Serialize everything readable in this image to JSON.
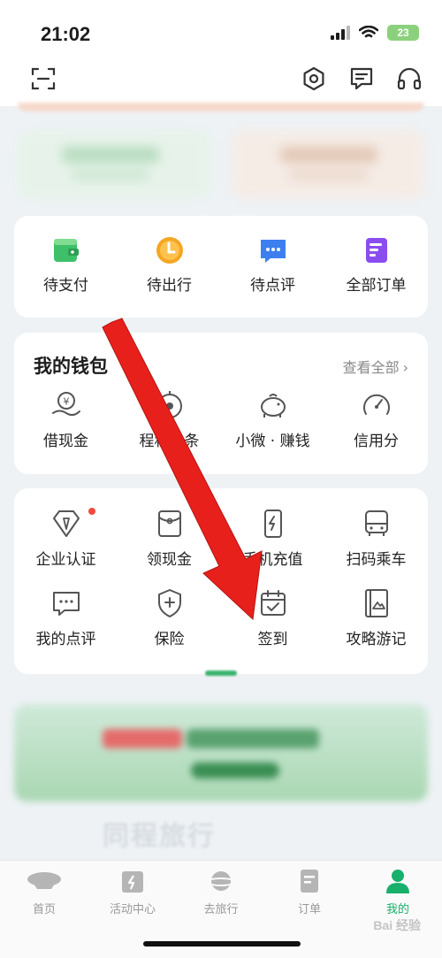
{
  "status_bar": {
    "time": "21:02",
    "battery": "23"
  },
  "orders": {
    "items": [
      {
        "label": "待支付",
        "icon": "wallet-icon"
      },
      {
        "label": "待出行",
        "icon": "clock-icon"
      },
      {
        "label": "待点评",
        "icon": "comment-icon"
      },
      {
        "label": "全部订单",
        "icon": "order-list-icon"
      }
    ]
  },
  "wallet": {
    "title": "我的钱包",
    "more": "查看全部",
    "items": [
      {
        "label": "借现金",
        "icon": "cash-hand-icon"
      },
      {
        "label": "程程白条",
        "icon": "credit-bar-icon"
      },
      {
        "label": "小微 · 赚钱",
        "icon": "piggy-bank-icon"
      },
      {
        "label": "信用分",
        "icon": "gauge-icon"
      }
    ]
  },
  "services": {
    "row1": [
      {
        "label": "企业认证",
        "icon": "diamond-tie-icon"
      },
      {
        "label": "领现金",
        "icon": "red-packet-icon"
      },
      {
        "label": "手机充值",
        "icon": "phone-charge-icon"
      },
      {
        "label": "扫码乘车",
        "icon": "bus-icon"
      }
    ],
    "row2": [
      {
        "label": "我的点评",
        "icon": "chat-bubble-icon"
      },
      {
        "label": "保险",
        "icon": "shield-plus-icon"
      },
      {
        "label": "签到",
        "icon": "calendar-check-icon"
      },
      {
        "label": "攻略游记",
        "icon": "travel-guide-icon"
      }
    ]
  },
  "brand": "同程旅行",
  "tabs": [
    {
      "label": "首页",
      "icon": "home-airship-icon"
    },
    {
      "label": "活动中心",
      "icon": "activity-calendar-icon"
    },
    {
      "label": "去旅行",
      "icon": "planet-icon"
    },
    {
      "label": "订单",
      "icon": "order-icon"
    },
    {
      "label": "我的",
      "icon": "profile-icon",
      "active": true
    }
  ],
  "watermark": "Bai 经验",
  "colors": {
    "accent": "#18b06a",
    "arrow": "#e8201b"
  }
}
